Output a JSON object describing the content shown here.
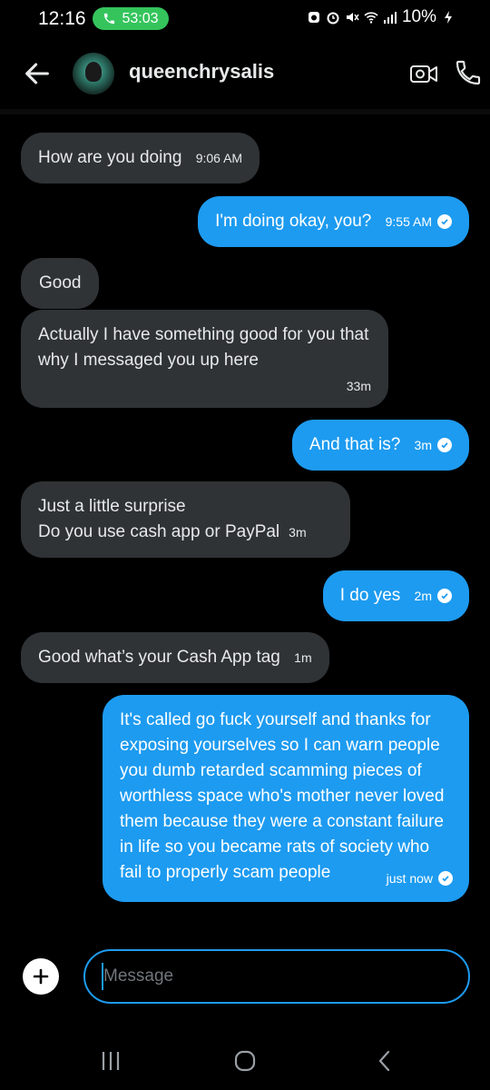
{
  "status_bar": {
    "time": "12:16",
    "call_duration": "53:03",
    "battery": "10%"
  },
  "header": {
    "username": "queenchrysalis"
  },
  "messages": [
    {
      "dir": "recv",
      "text": "How are you doing",
      "time": "9:06 AM"
    },
    {
      "dir": "sent",
      "text": "I'm doing okay, you?",
      "time": "9:55 AM"
    },
    {
      "dir": "recv",
      "text": "Good",
      "time": ""
    },
    {
      "dir": "recv",
      "text": "Actually I have something good for you that why I messaged you up here",
      "time": "33m"
    },
    {
      "dir": "sent",
      "text": "And that is?",
      "time": "3m"
    },
    {
      "dir": "recv",
      "text": "Just a little surprise\nDo you use cash app or PayPal",
      "time": "3m"
    },
    {
      "dir": "sent",
      "text": "I do yes",
      "time": "2m"
    },
    {
      "dir": "recv",
      "text": "Good what’s your Cash App tag",
      "time": "1m"
    },
    {
      "dir": "sent",
      "text": "It's called go fuck yourself and thanks for exposing yourselves so I can warn people you dumb retarded scamming pieces of worthless space who's mother never loved them because they were a constant failure in life so you became rats of society who fail to properly scam people",
      "time": "just now"
    }
  ],
  "composer": {
    "placeholder": "Message"
  },
  "colors": {
    "sent_bubble": "#1d9bf0",
    "recv_bubble": "#2f3336",
    "call_pill": "#35c45c"
  },
  "icons": [
    "back-arrow-icon",
    "video-call-icon",
    "phone-icon",
    "add-icon",
    "read-check-icon"
  ]
}
